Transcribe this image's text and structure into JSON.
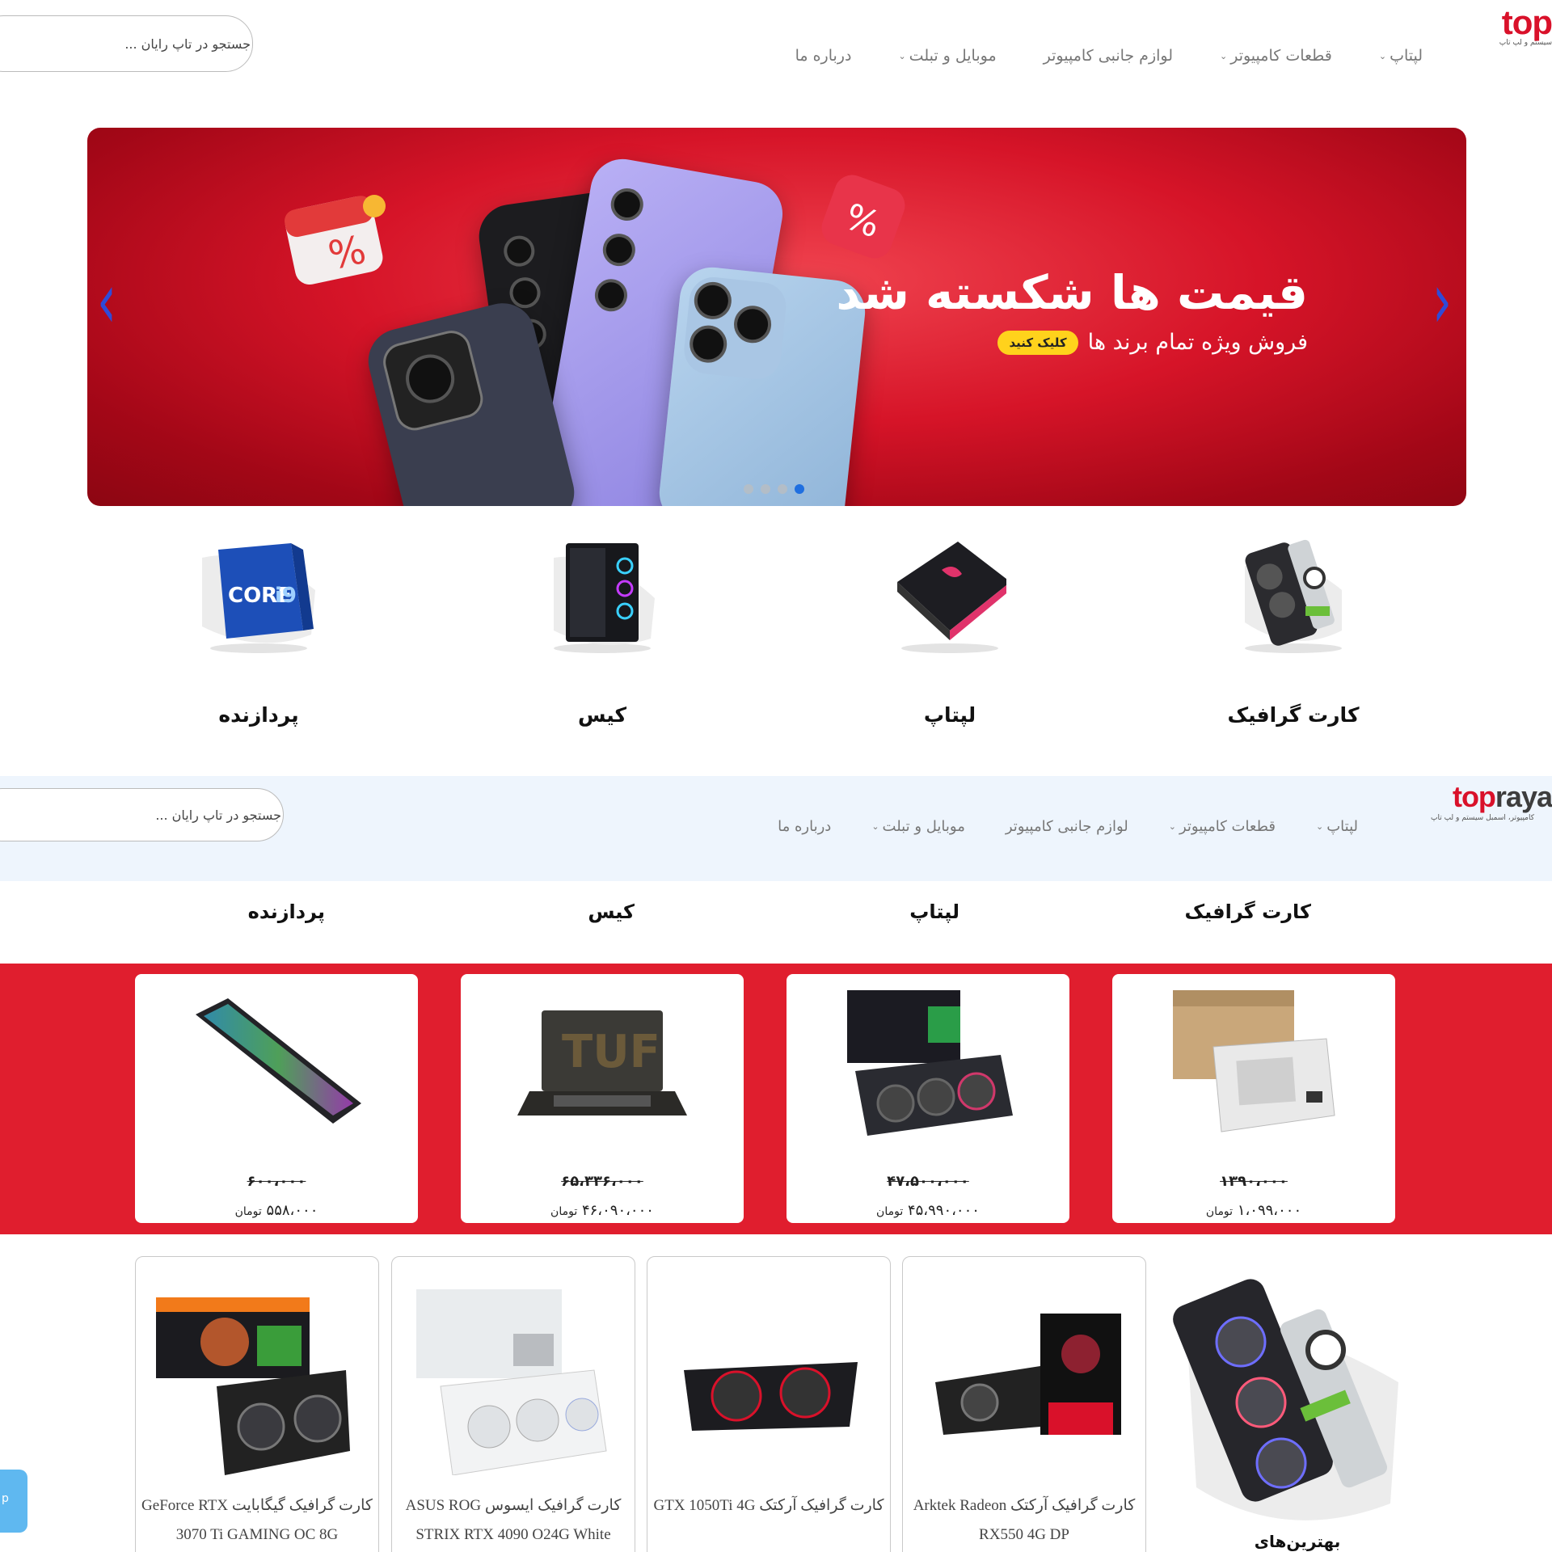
{
  "header": {
    "logo_text_red": "top",
    "logo_sub": "سیستم و لپ تاپ",
    "nav": [
      {
        "label": "لپتاپ",
        "has_dropdown": true
      },
      {
        "label": "قطعات کامپیوتر",
        "has_dropdown": true
      },
      {
        "label": "لوازم جانبی کامپیوتر",
        "has_dropdown": false
      },
      {
        "label": "موبایل و تبلت",
        "has_dropdown": true
      },
      {
        "label": "درباره ما",
        "has_dropdown": false
      }
    ],
    "search_placeholder": "جستجو در تاپ رایان ..."
  },
  "banner": {
    "title": "قیمت ها شکسته شد",
    "subtitle": "فروش ویژه تمام برند ها",
    "cta": "کلیک کنید",
    "slides": 4,
    "active_slide": 4,
    "prev_icon": "chevron-left-icon",
    "next_icon": "chevron-right-icon"
  },
  "categories": [
    "کارت گرافیک",
    "لپتاپ",
    "کیس",
    "پردازنده"
  ],
  "sticky_header": {
    "logo_text_red": "top",
    "logo_text_dark": "raya",
    "logo_sub": "کامپیوتر، اسمبل سیستم و لپ تاپ",
    "nav": [
      {
        "label": "لپتاپ",
        "has_dropdown": true
      },
      {
        "label": "قطعات کامپیوتر",
        "has_dropdown": true
      },
      {
        "label": "لوازم جانبی کامپیوتر",
        "has_dropdown": false
      },
      {
        "label": "موبایل و تبلت",
        "has_dropdown": true
      },
      {
        "label": "درباره ما",
        "has_dropdown": false
      }
    ],
    "search_placeholder": "جستجو در تاپ رایان ..."
  },
  "discounts": [
    {
      "old_price": "۱۳۹۰،۰۰۰",
      "new_price": "۱،۰۹۹،۰۰۰",
      "unit": "تومان",
      "kind": "power-supply"
    },
    {
      "old_price": "۴۷،۵۰۰،۰۰۰",
      "new_price": "۴۵،۹۹۰،۰۰۰",
      "unit": "تومان",
      "kind": "graphics-card"
    },
    {
      "old_price": "۶۵،۳۳۶،۰۰۰",
      "new_price": "۴۶،۰۹۰،۰۰۰",
      "unit": "تومان",
      "kind": "laptop"
    },
    {
      "old_price": "۶۰۰،۰۰۰",
      "new_price": "۵۵۸،۰۰۰",
      "unit": "تومان",
      "kind": "keyboard"
    }
  ],
  "best_products": {
    "title": "بهترین‌های",
    "items": [
      {
        "name": "کارت گرافیک آرکتک Arktek Radeon RX550 4G DP"
      },
      {
        "name": "کارت گرافیک آرکتک GTX 1050Ti 4G"
      },
      {
        "name": "کارت گرافیک ایسوس ASUS ROG STRIX RTX 4090 O24G White"
      },
      {
        "name": "کارت گرافیک گیگابایت GeForce RTX 3070 Ti GAMING OC 8G"
      }
    ]
  },
  "chat_tab_label": "p",
  "colors": {
    "brand_red": "#d9112a",
    "strip_red": "#e01e2e",
    "cta_yellow": "#ffd21c",
    "dot_active": "#1f6fe0"
  }
}
